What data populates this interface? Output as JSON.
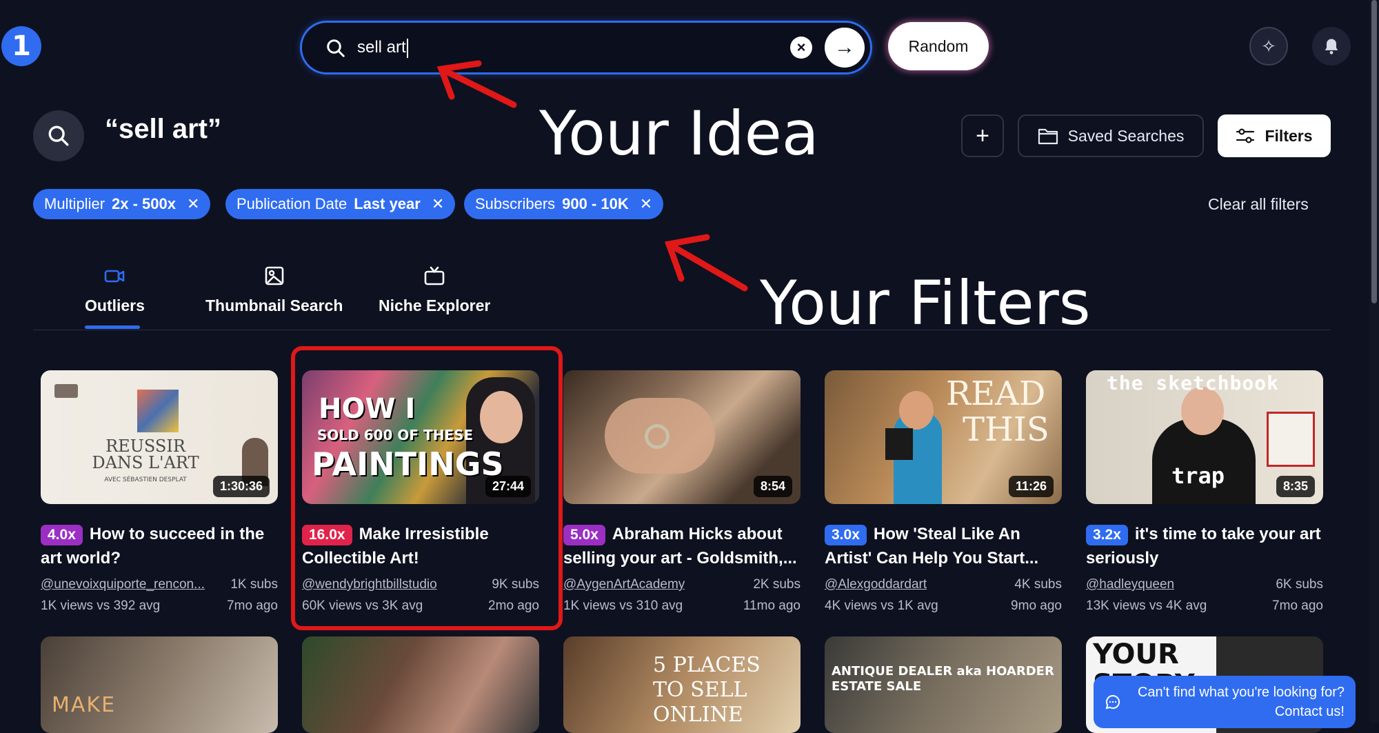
{
  "header": {
    "logo_text": "1",
    "search_value": "sell art",
    "random_label": "Random",
    "icons": [
      "search-icon",
      "clear-icon",
      "arrow-right-icon",
      "sparkle-icon",
      "bell-icon"
    ]
  },
  "query": {
    "text": "“sell art”",
    "saved_searches_label": "Saved Searches",
    "filters_label": "Filters",
    "plus_label": "+"
  },
  "annotations": {
    "idea": "Your Idea",
    "filters": "Your Filters",
    "color": "#e01818"
  },
  "chips": [
    {
      "key": "Multiplier",
      "value": "2x - 500x"
    },
    {
      "key": "Publication Date",
      "value": "Last year"
    },
    {
      "key": "Subscribers",
      "value": "900 - 10K"
    }
  ],
  "clear_all_label": "Clear all filters",
  "tabs": [
    {
      "label": "Outliers",
      "active": true
    },
    {
      "label": "Thumbnail Search",
      "active": false
    },
    {
      "label": "Niche Explorer",
      "active": false
    }
  ],
  "videos": [
    {
      "multiplier": "4.0x",
      "badge_color": "#9b2fc4",
      "title": "How to succeed in the art world?",
      "channel": "@unevoixquiporte_rencon...",
      "subs": "1K subs",
      "views": "1K views vs 392 avg",
      "age": "7mo ago",
      "duration": "1:30:36",
      "thumb_text": [
        "REUSSIR",
        "DANS L'ART",
        "AVEC SÉBASTIEN DESPLAT"
      ]
    },
    {
      "multiplier": "16.0x",
      "badge_color": "#e0234a",
      "title": "Make Irresistible Collectible Art!",
      "channel": "@wendybrightbillstudio",
      "subs": "9K subs",
      "views": "60K views vs 3K avg",
      "age": "2mo ago",
      "duration": "27:44",
      "thumb_text": [
        "HOW I",
        "SOLD 600 OF THESE",
        "PAINTINGS"
      ]
    },
    {
      "multiplier": "5.0x",
      "badge_color": "#9b2fc4",
      "title": "Abraham Hicks about selling your art - Goldsmith,...",
      "channel": "@AygenArtAcademy",
      "subs": "2K subs",
      "views": "1K views vs 310 avg",
      "age": "11mo ago",
      "duration": "8:54",
      "thumb_text": []
    },
    {
      "multiplier": "3.0x",
      "badge_color": "#2f6cf0",
      "title": "How 'Steal Like An Artist' Can Help You Start...",
      "channel": "@Alexgoddardart",
      "subs": "4K subs",
      "views": "4K views vs 1K avg",
      "age": "9mo ago",
      "duration": "11:26",
      "thumb_text": [
        "READ",
        "THIS"
      ]
    },
    {
      "multiplier": "3.2x",
      "badge_color": "#2f6cf0",
      "title": "it's time to take your art seriously",
      "channel": "@hadleyqueen",
      "subs": "6K subs",
      "views": "13K views vs 4K avg",
      "age": "7mo ago",
      "duration": "8:35",
      "thumb_text": [
        "the sketchbook",
        "trap"
      ]
    }
  ],
  "row2_thumb_text": [
    "MAKE",
    "",
    "5 PLACES TO SELL ONLINE",
    "ANTIQUE DEALER aka HOARDER ESTATE SALE",
    "YOUR STORY"
  ],
  "contact": {
    "line1": "Can't find what you're looking for?",
    "line2": "Contact us!"
  }
}
